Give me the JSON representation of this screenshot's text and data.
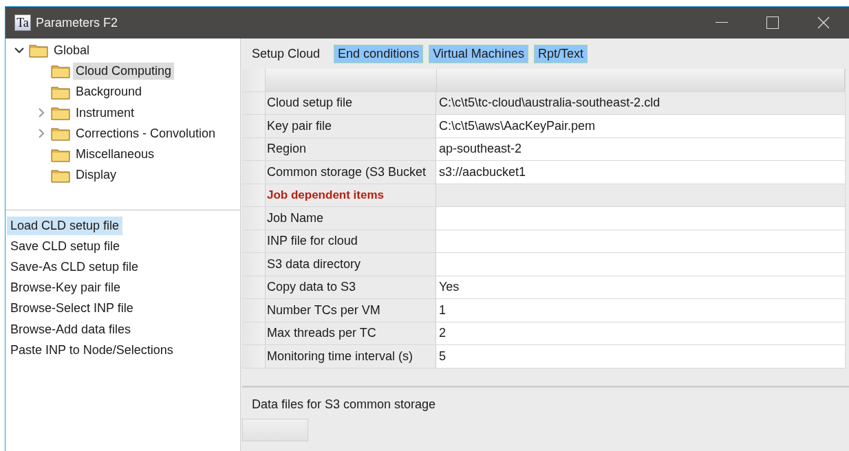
{
  "window": {
    "app_icon": "Ta",
    "title": "Parameters F2"
  },
  "tree": [
    {
      "label": "Global",
      "expanded": true,
      "selected": false,
      "children": [
        {
          "label": "Cloud Computing",
          "selected": true
        },
        {
          "label": "Background",
          "selected": false
        },
        {
          "label": "Instrument",
          "expanded": false,
          "selected": false
        },
        {
          "label": "Corrections - Convolution",
          "expanded": false,
          "selected": false
        },
        {
          "label": "Miscellaneous",
          "selected": false
        },
        {
          "label": "Display",
          "selected": false
        }
      ]
    }
  ],
  "actions": [
    {
      "label": "Load CLD setup file",
      "selected": true
    },
    {
      "label": "Save CLD setup file",
      "selected": false
    },
    {
      "label": "Save-As CLD setup file",
      "selected": false
    },
    {
      "label": "Browse-Key pair file",
      "selected": false
    },
    {
      "label": "Browse-Select INP file",
      "selected": false
    },
    {
      "label": "Browse-Add data files",
      "selected": false
    },
    {
      "label": "Paste INP to Node/Selections",
      "selected": false
    }
  ],
  "tabs": [
    {
      "label": "Setup Cloud",
      "selected": true
    },
    {
      "label": "End conditions",
      "selected": false
    },
    {
      "label": "Virtual Machines",
      "selected": false
    },
    {
      "label": "Rpt/Text",
      "selected": false
    }
  ],
  "table": {
    "rows": [
      {
        "kind": "field",
        "label": "Cloud setup file",
        "value": "C:\\c\\t5\\tc-cloud\\australia-southeast-2.cld",
        "selected": true
      },
      {
        "kind": "field",
        "label": "Key pair file",
        "value": "C:\\c\\t5\\aws\\AacKeyPair.pem",
        "selected": false
      },
      {
        "kind": "field",
        "label": "Region",
        "value": "ap-southeast-2",
        "selected": false
      },
      {
        "kind": "field",
        "label": "Common storage (S3 Bucket",
        "value": "s3://aacbucket1",
        "selected": false
      },
      {
        "kind": "section",
        "label": "Job dependent items"
      },
      {
        "kind": "field",
        "label": "Job Name",
        "selected": false
      },
      {
        "kind": "field",
        "label": "INP file for cloud",
        "selected": false
      },
      {
        "kind": "field",
        "label": "S3 data directory",
        "selected": false
      },
      {
        "kind": "field",
        "label": "Copy data to S3",
        "value": "Yes",
        "selected": false
      },
      {
        "kind": "field",
        "label": "Number TCs per VM",
        "value": "1",
        "selected": false
      },
      {
        "kind": "field",
        "label": "Max threads per TC",
        "value": "2",
        "selected": false
      },
      {
        "kind": "field",
        "label": "Monitoring time interval (s)",
        "value": "5",
        "selected": false
      }
    ]
  },
  "data_files": {
    "label": "Data files for S3 common storage"
  }
}
